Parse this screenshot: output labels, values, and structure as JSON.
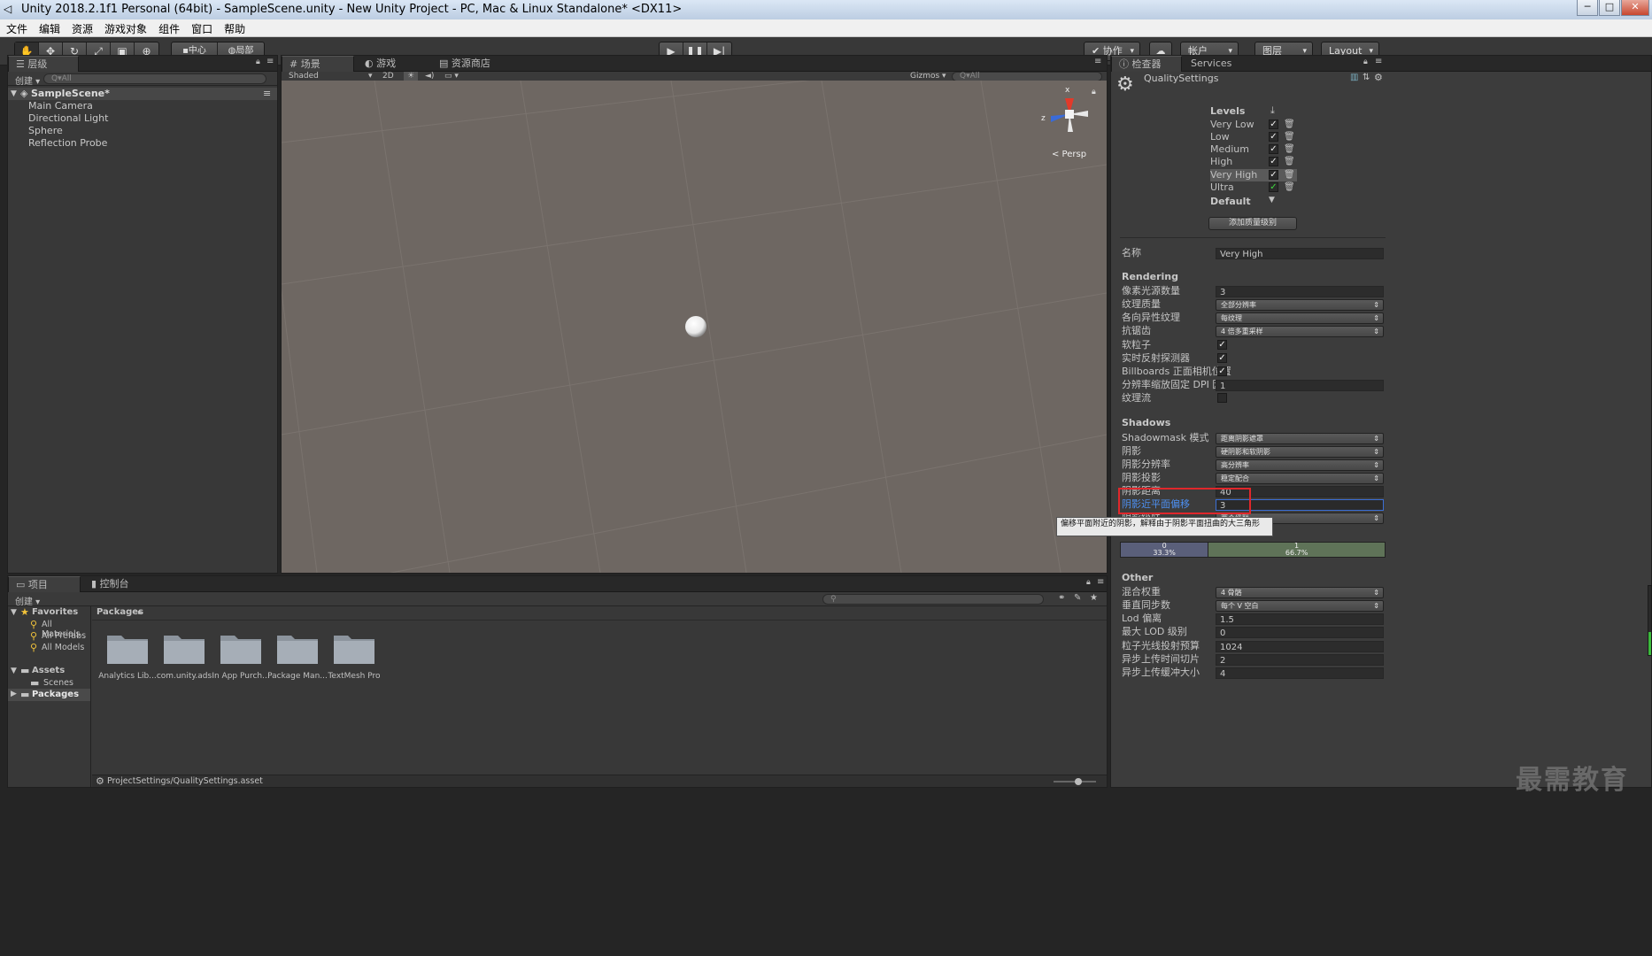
{
  "window": {
    "title": "Unity 2018.2.1f1 Personal (64bit) - SampleScene.unity - New Unity Project - PC, Mac & Linux Standalone* <DX11>",
    "controls": [
      "─",
      "□",
      "✕"
    ]
  },
  "menu": [
    "文件",
    "编辑",
    "资源",
    "游戏对象",
    "组件",
    "窗口",
    "帮助"
  ],
  "toolbar": {
    "pivot": "中心",
    "space": "局部",
    "collab": "协作",
    "account": "帐户",
    "layers": "图层",
    "layout": "Layout"
  },
  "hierarchy": {
    "tab": "层级",
    "create": "创建",
    "search_placeholder": "Q▾All",
    "scene": "SampleScene*",
    "items": [
      "Main Camera",
      "Directional Light",
      "Sphere",
      "Reflection Probe"
    ]
  },
  "scene_view": {
    "tabs": [
      "场景",
      "游戏",
      "资源商店"
    ],
    "shading": "Shaded",
    "mode_2d": "2D",
    "gizmos": "Gizmos",
    "search_placeholder": "Q▾All",
    "persp": "< Persp",
    "axis_x": "x",
    "axis_z": "z"
  },
  "inspector": {
    "tabs": [
      "检查器",
      "Services"
    ],
    "object_name": "QualitySettings",
    "levels_header": "Levels",
    "levels": [
      "Very Low",
      "Low",
      "Medium",
      "High",
      "Very High",
      "Ultra"
    ],
    "default_label": "Default",
    "add_level_button": "添加质量级别",
    "name_label": "名称",
    "name_value": "Very High",
    "rendering_header": "Rendering",
    "rendering": {
      "pixel_light_label": "像素光源数量",
      "pixel_light_value": "3",
      "texture_quality_label": "纹理质量",
      "texture_quality_value": "全部分辨率",
      "aniso_label": "各向异性纹理",
      "aniso_value": "每纹理",
      "aa_label": "抗锯齿",
      "aa_value": "4 倍多重采样",
      "soft_particles_label": "软粒子",
      "realtime_reflection_label": "实时反射探测器",
      "billboards_label": "Billboards 正面相机位置",
      "dpi_label": "分辨率缩放固定 DPI 因子",
      "dpi_value": "1",
      "texture_streaming_label": "纹理流"
    },
    "shadows_header": "Shadows",
    "shadows": {
      "shadowmask_label": "Shadowmask 模式",
      "shadowmask_value": "距离阴影遮罩",
      "shadows_label": "阴影",
      "shadows_value": "硬阴影和软阴影",
      "resolution_label": "阴影分辨率",
      "resolution_value": "高分辨率",
      "projection_label": "阴影投影",
      "projection_value": "稳定配合",
      "distance_label": "阴影距离",
      "distance_value": "40",
      "near_plane_label": "阴影近平面偏移",
      "near_plane_value": "3",
      "cascades_label": "阴影级联",
      "cascades_value": "两个级联"
    },
    "tooltip": "偏移平面附近的阴影，解释由于阴影平面扭曲的大三角形",
    "cascade_bar": [
      {
        "index": "0",
        "percent": "33.3%",
        "fraction": 0.333
      },
      {
        "index": "1",
        "percent": "66.7%",
        "fraction": 0.667
      }
    ],
    "other_header": "Other",
    "other": {
      "blend_label": "混合权重",
      "blend_value": "4 骨骼",
      "vsync_label": "垂直同步数",
      "vsync_value": "每个 V 空白",
      "lod_bias_label": "Lod 偏离",
      "lod_bias_value": "1.5",
      "max_lod_label": "最大 LOD 级别",
      "max_lod_value": "0",
      "raycast_label": "粒子光线投射预算",
      "raycast_value": "1024",
      "async_time_label": "异步上传时间切片",
      "async_time_value": "2",
      "async_buffer_label": "异步上传缓冲大小",
      "async_buffer_value": "4"
    }
  },
  "project": {
    "tabs": [
      "项目",
      "控制台"
    ],
    "create": "创建",
    "favorites": "Favorites",
    "favorite_items": [
      "All Materials",
      "All Prefabs",
      "All Models"
    ],
    "assets": "Assets",
    "scenes": "Scenes",
    "packages": "Packages",
    "breadcrumb": "Packages",
    "folders": [
      "Analytics Lib...",
      "com.unity.ads",
      "In App Purch...",
      "Package Man...",
      "TextMesh Pro"
    ],
    "status_path": "ProjectSettings/QualitySettings.asset"
  },
  "watermark": "最需教育",
  "colors": {
    "highlight_box": "#e0272b",
    "selected_label": "#4d8ff0",
    "cascade_0": "#5a5f7a",
    "cascade_1": "#5f7358"
  }
}
